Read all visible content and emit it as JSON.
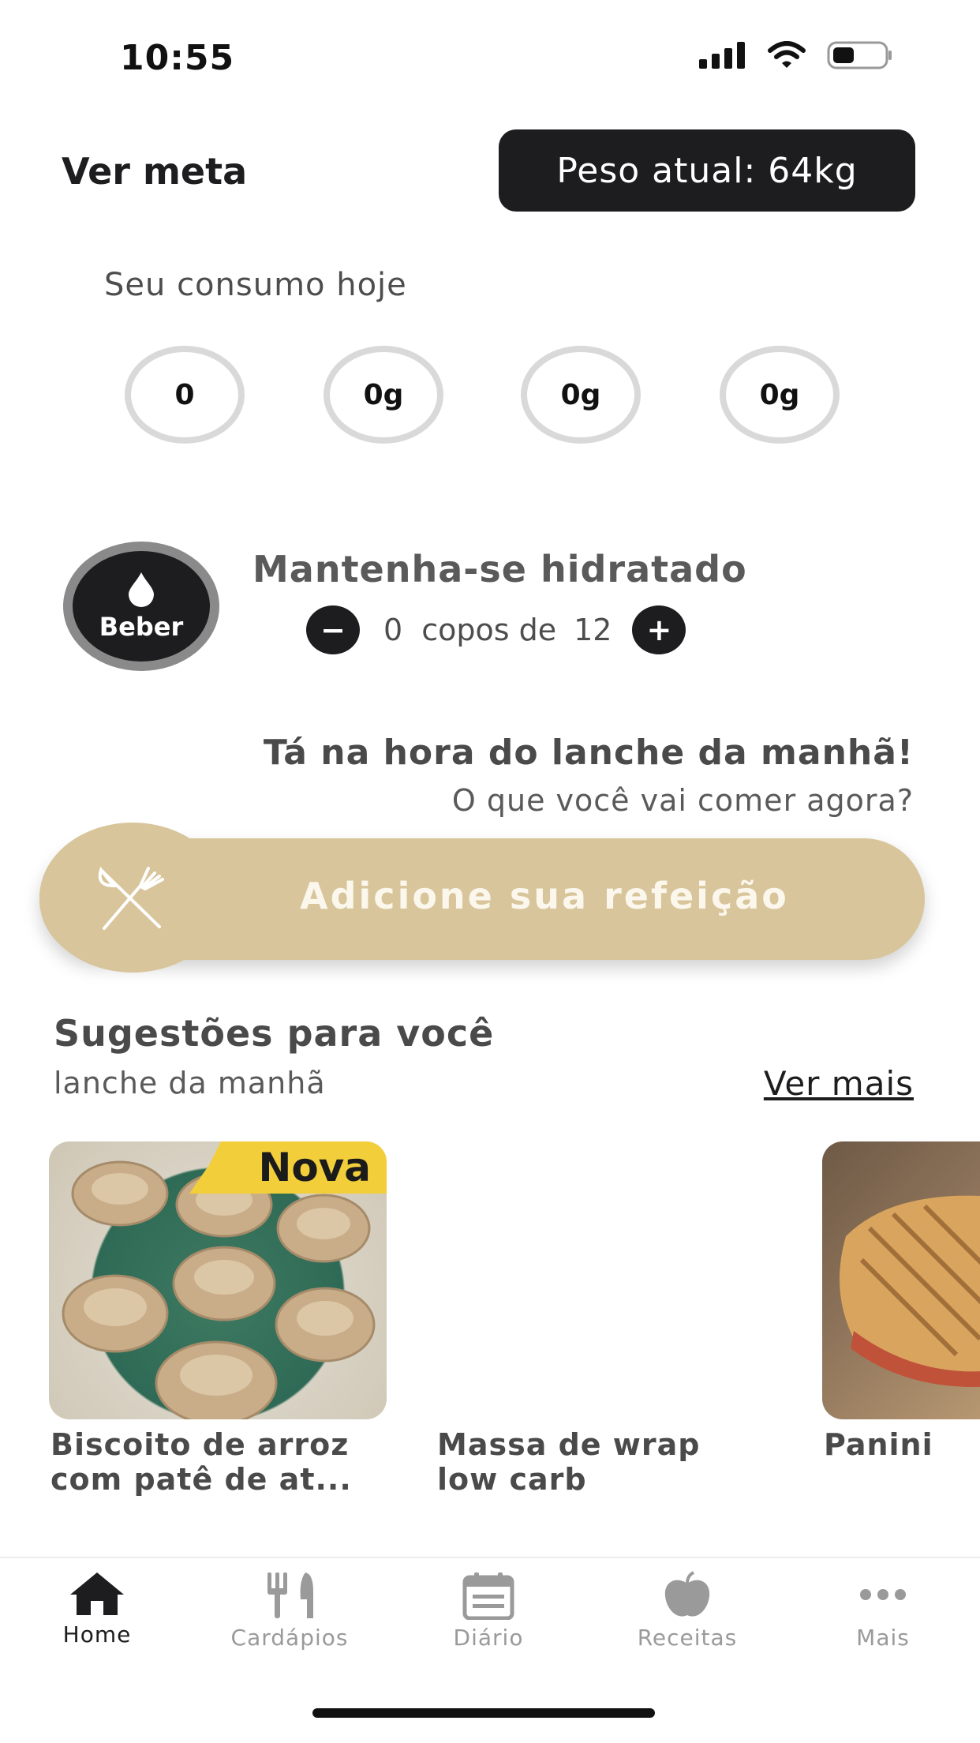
{
  "status_bar": {
    "time": "10:55"
  },
  "header": {
    "ver_meta": "Ver meta",
    "peso_atual": "Peso atual: 64kg"
  },
  "consumo": {
    "title": "Seu consumo hoje",
    "rings": [
      "0",
      "0g",
      "0g",
      "0g"
    ]
  },
  "hidratacao": {
    "button_label": "Beber",
    "title": "Mantenha-se hidratado",
    "count": "0",
    "copos_de": "copos de",
    "goal": "12",
    "minus": "−",
    "plus": "+"
  },
  "meal": {
    "title": "Tá na hora do lanche da manhã!",
    "subtitle": "O que você vai comer agora?",
    "add_label": "Adicione sua refeição"
  },
  "suggestions": {
    "title": "Sugestões para você",
    "subtitle": "lanche da manhã",
    "ver_mais": "Ver mais",
    "cards": [
      {
        "title_line1": "Biscoito de arroz",
        "title_line2": "com patê de at...",
        "badge": "Nova"
      },
      {
        "title_line1": "Massa de wrap",
        "title_line2": "low carb"
      },
      {
        "title_line1": "Panini",
        "title_line2": ""
      }
    ]
  },
  "tabbar": {
    "items": [
      {
        "label": "Home",
        "icon": "home-icon",
        "active": true
      },
      {
        "label": "Cardápios",
        "icon": "cutlery-icon",
        "active": false
      },
      {
        "label": "Diário",
        "icon": "calendar-icon",
        "active": false
      },
      {
        "label": "Receitas",
        "icon": "apple-icon",
        "active": false
      },
      {
        "label": "Mais",
        "icon": "more-icon",
        "active": false
      }
    ]
  },
  "colors": {
    "dark": "#1d1d1f",
    "accent_gold": "#d8c59b",
    "badge_yellow": "#f2cf3a",
    "ring_gray": "#d9d9d9"
  }
}
